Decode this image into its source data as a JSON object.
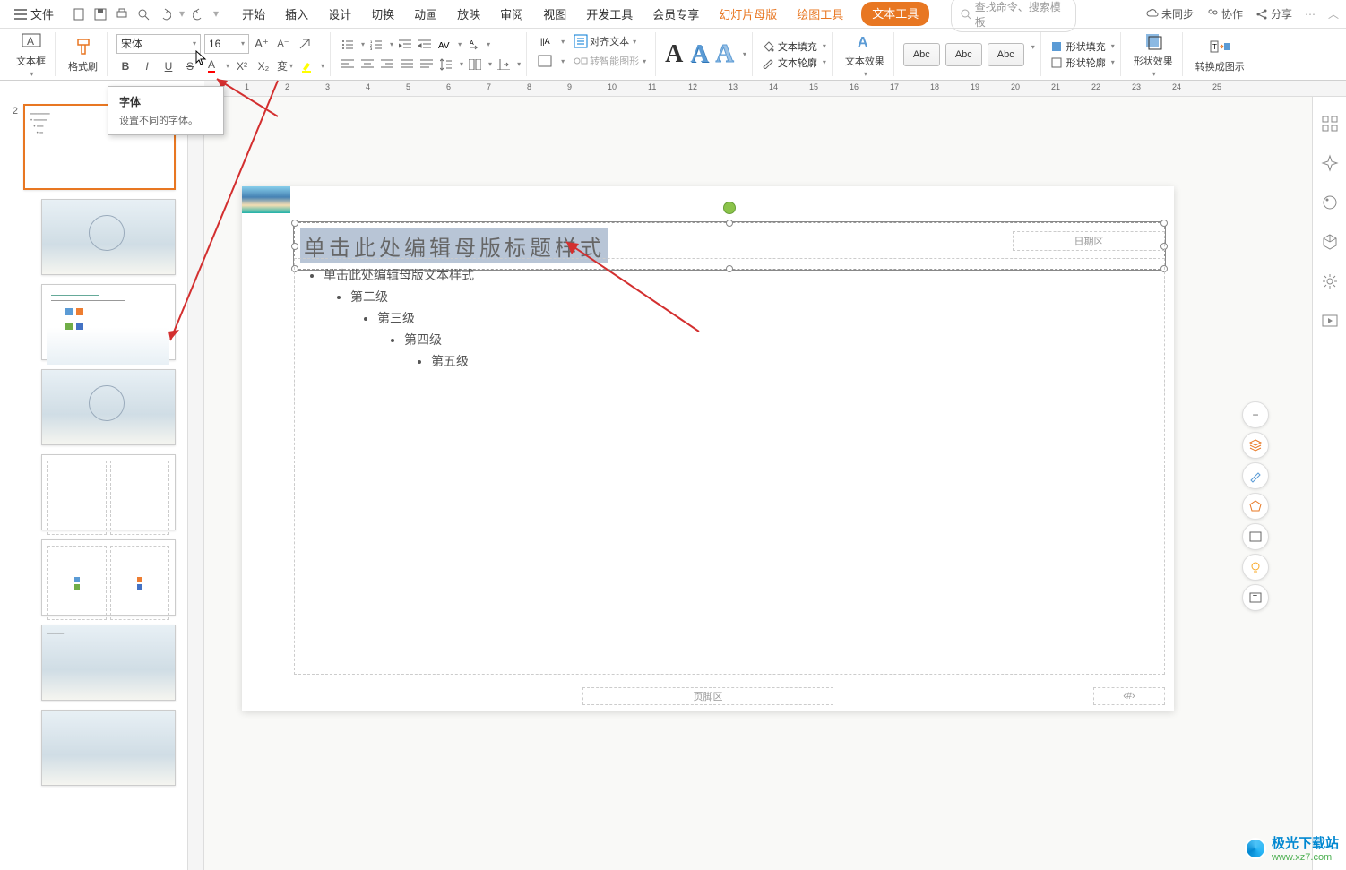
{
  "menu": {
    "file": "文件",
    "tabs": [
      "开始",
      "插入",
      "设计",
      "切换",
      "动画",
      "放映",
      "审阅",
      "视图",
      "开发工具",
      "会员专享"
    ],
    "slidemaster": "幻灯片母版",
    "drawtools": "绘图工具",
    "texttools": "文本工具",
    "search_placeholder": "查找命令、搜索模板",
    "unsync": "未同步",
    "collab": "协作",
    "share": "分享"
  },
  "ribbon": {
    "textbox": "文本框",
    "formatpainter": "格式刷",
    "fontname": "宋体",
    "fontsize": "16",
    "aligntext": "对齐文本",
    "smartart": "转智能图形",
    "textfill": "文本填充",
    "textoutline": "文本轮廓",
    "texteffect": "文本效果",
    "preset": "Abc",
    "shapefill": "形状填充",
    "shapeoutline": "形状轮廓",
    "shapeeffect": "形状效果",
    "convert": "转换成图示"
  },
  "tooltip": {
    "title": "字体",
    "desc": "设置不同的字体。"
  },
  "slide": {
    "title": "单击此处编辑母版标题样式",
    "body1": "单击此处编辑母版文本样式",
    "l2": "第二级",
    "l3": "第三级",
    "l4": "第四级",
    "l5": "第五级",
    "date": "日期区",
    "footer": "页脚区",
    "pagenum": "‹#›"
  },
  "thumbs": {
    "num": "2"
  },
  "watermark": {
    "name": "极光下载站",
    "url": "www.xz7.com"
  }
}
